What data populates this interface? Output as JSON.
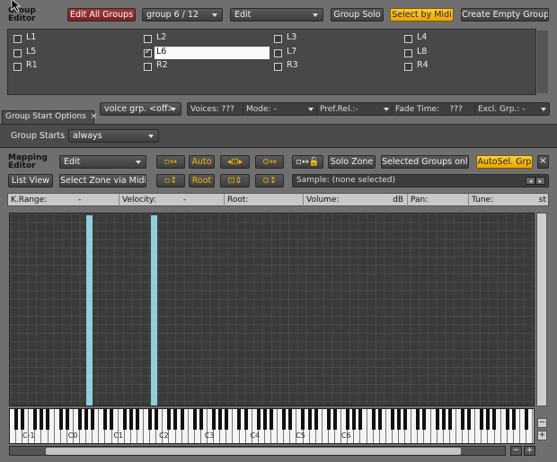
{
  "group_editor": {
    "title": "Group\nEditor",
    "edit_all_groups": "Edit All Groups",
    "group_select": "group 6 / 12",
    "edit_mode": "Edit",
    "group_solo": "Group Solo",
    "select_by_midi": "Select by Midi",
    "create_empty_group": "Create Empty Group",
    "groups": [
      {
        "label": "L1",
        "checked": false
      },
      {
        "label": "L2",
        "checked": false
      },
      {
        "label": "L3",
        "checked": false
      },
      {
        "label": "L4",
        "checked": false
      },
      {
        "label": "L5",
        "checked": false
      },
      {
        "label": "L6",
        "checked": true
      },
      {
        "label": "L7",
        "checked": false
      },
      {
        "label": "L8",
        "checked": false
      },
      {
        "label": "R1",
        "checked": false
      },
      {
        "label": "R2",
        "checked": false
      },
      {
        "label": "R3",
        "checked": false
      },
      {
        "label": "R4",
        "checked": false
      }
    ]
  },
  "tab": {
    "label": "Group Start Options",
    "close": "×"
  },
  "voice_bar": {
    "voice_group": "voice grp. <off>",
    "voices_label": "Voices:",
    "voices_value": "???",
    "mode_label": "Mode:",
    "mode_value": "-",
    "pref_rel_label": "Pref.Rel.:",
    "pref_rel_value": "-",
    "fade_time_label": "Fade Time:",
    "fade_time_value": "???",
    "excl_grp_label": "Excl. Grp.:",
    "excl_grp_value": "-"
  },
  "group_starts": {
    "label": "Group Starts",
    "value": "always"
  },
  "mapping_editor": {
    "title": "Mapping\nEditor",
    "edit_mode": "Edit",
    "list_view": "List View",
    "select_zone_via_midi": "Select Zone via Midi",
    "auto": "Auto",
    "root": "Root",
    "solo_zone": "Solo Zone",
    "selected_groups_only": "Selected Groups only",
    "autosel_grp": "AutoSel. Grp",
    "close": "×",
    "sample_label": "Sample:",
    "sample_value": "(none selected)"
  },
  "zone_info": {
    "krange_label": "K.Range:",
    "krange_value": "-",
    "velocity_label": "Velocity:",
    "velocity_value": "-",
    "root_label": "Root:",
    "volume_label": "Volume:",
    "volume_unit": "dB",
    "pan_label": "Pan:",
    "tune_label": "Tune:",
    "tune_unit": "st"
  },
  "keyboard": {
    "octaves": [
      "C-1",
      "C0",
      "C1",
      "C2",
      "C3",
      "C4",
      "C5",
      "C6"
    ]
  },
  "zones_fill_color": "#8ed0dc",
  "scroll": {
    "zoom_minus": "−",
    "zoom_plus": "+"
  }
}
